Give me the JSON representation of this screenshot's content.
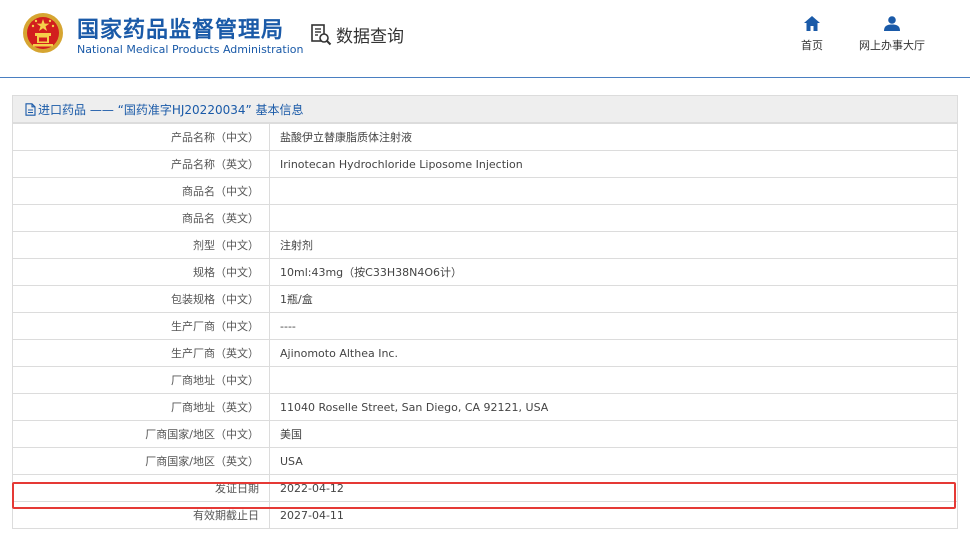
{
  "header": {
    "org_name_cn": "国家药品监督管理局",
    "org_name_en": "National Medical Products Administration",
    "search_label": "数据查询",
    "nav": [
      {
        "label": "首页",
        "icon": "home-icon"
      },
      {
        "label": "网上办事大厅",
        "icon": "user-icon"
      }
    ]
  },
  "panel": {
    "title": "进口药品 —— “国药准字HJ20220034” 基本信息",
    "rows": [
      {
        "key": "产品名称（中文）",
        "value": "盐酸伊立替康脂质体注射液"
      },
      {
        "key": "产品名称（英文）",
        "value": "Irinotecan Hydrochloride Liposome Injection"
      },
      {
        "key": "商品名（中文）",
        "value": ""
      },
      {
        "key": "商品名（英文）",
        "value": ""
      },
      {
        "key": "剂型（中文）",
        "value": "注射剂"
      },
      {
        "key": "规格（中文）",
        "value": "10ml:43mg（按C33H38N4O6计）"
      },
      {
        "key": "包装规格（中文）",
        "value": "1瓶/盒"
      },
      {
        "key": "生产厂商（中文）",
        "value": "----"
      },
      {
        "key": "生产厂商（英文）",
        "value": "Ajinomoto Althea Inc."
      },
      {
        "key": "厂商地址（中文）",
        "value": ""
      },
      {
        "key": "厂商地址（英文）",
        "value": "11040 Roselle Street, San Diego, CA 92121, USA"
      },
      {
        "key": "厂商国家/地区（中文）",
        "value": "美国"
      },
      {
        "key": "厂商国家/地区（英文）",
        "value": "USA"
      },
      {
        "key": "发证日期",
        "value": "2022-04-12"
      },
      {
        "key": "有效期截止日",
        "value": "2027-04-11"
      }
    ]
  },
  "colors": {
    "brand_blue": "#1a5aa8",
    "highlight_red": "#e53935"
  }
}
